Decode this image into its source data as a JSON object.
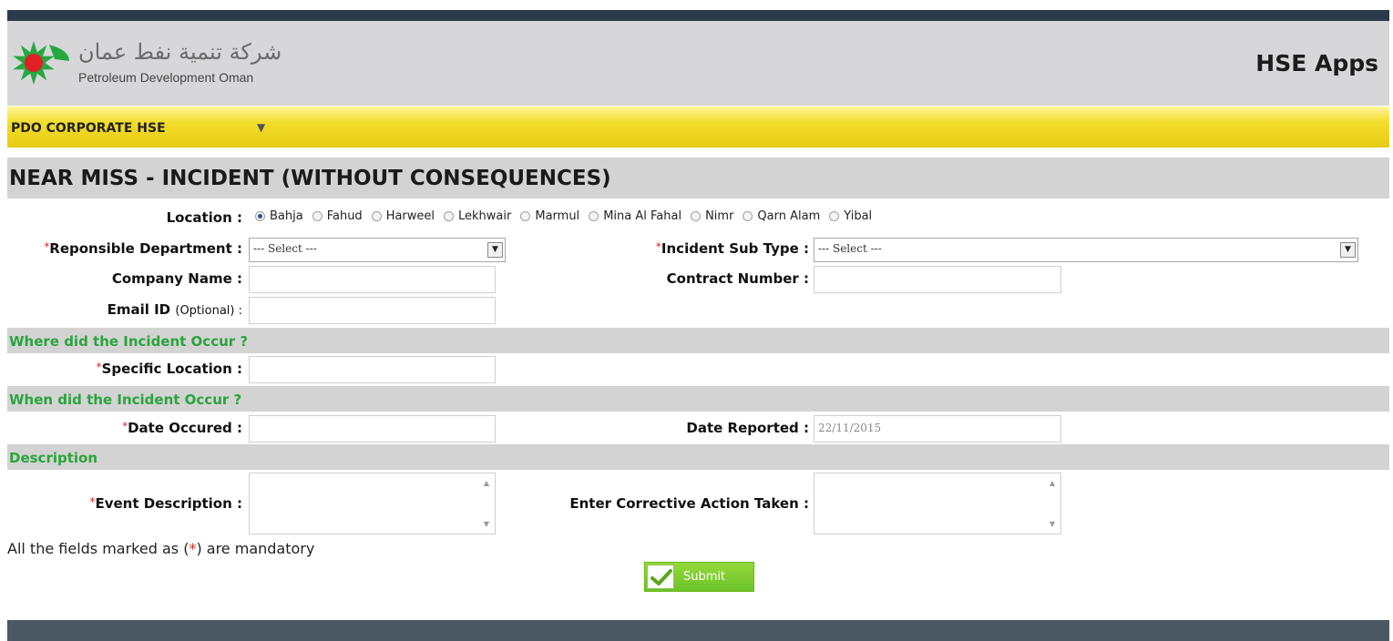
{
  "header": {
    "logo_arabic": "شركة تنمية نفط عمان",
    "logo_english": "Petroleum Development Oman",
    "app_title": "HSE Apps",
    "brand_colors": {
      "green": "#26a840",
      "red": "#e01f26",
      "dark_bar": "#2b3a4a"
    }
  },
  "nav": {
    "menu_label": "PDO CORPORATE HSE",
    "arrow": "▼"
  },
  "page": {
    "title": "NEAR MISS - INCIDENT (WITHOUT CONSEQUENCES)"
  },
  "form": {
    "location_label": "Location :",
    "locations": [
      "Bahja",
      "Fahud",
      "Harweel",
      "Lekhwair",
      "Marmul",
      "Mina Al Fahal",
      "Nimr",
      "Qarn Alam",
      "Yibal"
    ],
    "location_selected": "Bahja",
    "req_mark": "*",
    "dept_label": "Reponsible Department :",
    "dept_value": "--- Select ---",
    "subtype_label": "Incident Sub Type :",
    "subtype_value": "--- Select ---",
    "company_label": "Company Name :",
    "company_value": "",
    "contract_label": "Contract Number :",
    "contract_value": "",
    "email_label": "Email ID",
    "email_optional": "(Optional) :",
    "email_value": "",
    "section_where": "Where did the Incident Occur ?",
    "specific_location_label": "Specific Location :",
    "specific_location_value": "",
    "section_when": "When did the Incident Occur ?",
    "date_occured_label": "Date Occured :",
    "date_occured_value": "",
    "date_reported_label": "Date Reported :",
    "date_reported_value": "22/11/2015",
    "section_description": "Description",
    "event_description_label": "Event Description :",
    "corrective_action_label": "Enter Corrective Action Taken :",
    "mandatory_prefix": "All the fields marked as (",
    "mandatory_star": "*",
    "mandatory_suffix": ") are mandatory",
    "submit_label": "Submit",
    "select_arrow": "▼",
    "scroll_up": "▲",
    "scroll_down": "▼"
  }
}
